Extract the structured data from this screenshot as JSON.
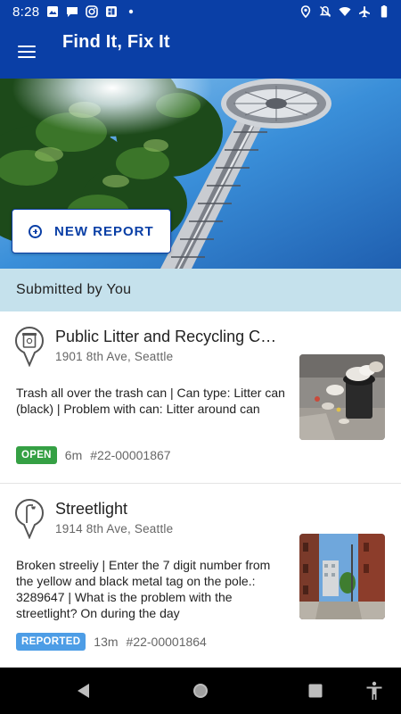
{
  "status_bar": {
    "time": "8:28",
    "left_icons": [
      "image-icon",
      "chat-icon",
      "instagram-icon",
      "app-icon",
      "dot-icon"
    ],
    "right_icons": [
      "location-icon",
      "mute-icon",
      "wifi-icon",
      "airplane-icon",
      "battery-icon"
    ]
  },
  "app_bar": {
    "title": "Find It, Fix It",
    "background": "#0a3fa6"
  },
  "hero": {
    "button_label": "NEW REPORT"
  },
  "section": {
    "title": "Submitted by You",
    "background": "#c5e1ec"
  },
  "reports": [
    {
      "title": "Public Litter and Recycling C…",
      "address": "1901 8th Ave, Seattle",
      "description": "Trash all over the trash can | Can type: Litter can (black) | Problem with can: Litter around can",
      "status": "OPEN",
      "status_color": "#35a044",
      "age": "6m",
      "id": "#22-00001867",
      "icon": "litter-can-pin-icon"
    },
    {
      "title": "Streetlight",
      "address": "1914 8th Ave, Seattle",
      "description": "Broken streeliy | Enter the 7 digit number from the yellow and black metal tag on the pole.: 3289647 | What is the problem with the streetlight? On during the day",
      "status": "REPORTED",
      "status_color": "#4d9de6",
      "age": "13m",
      "id": "#22-00001864",
      "icon": "streetlight-pin-icon"
    }
  ],
  "nav_bar": {
    "buttons": [
      "back-icon",
      "home-icon",
      "recents-icon",
      "accessibility-icon"
    ]
  }
}
